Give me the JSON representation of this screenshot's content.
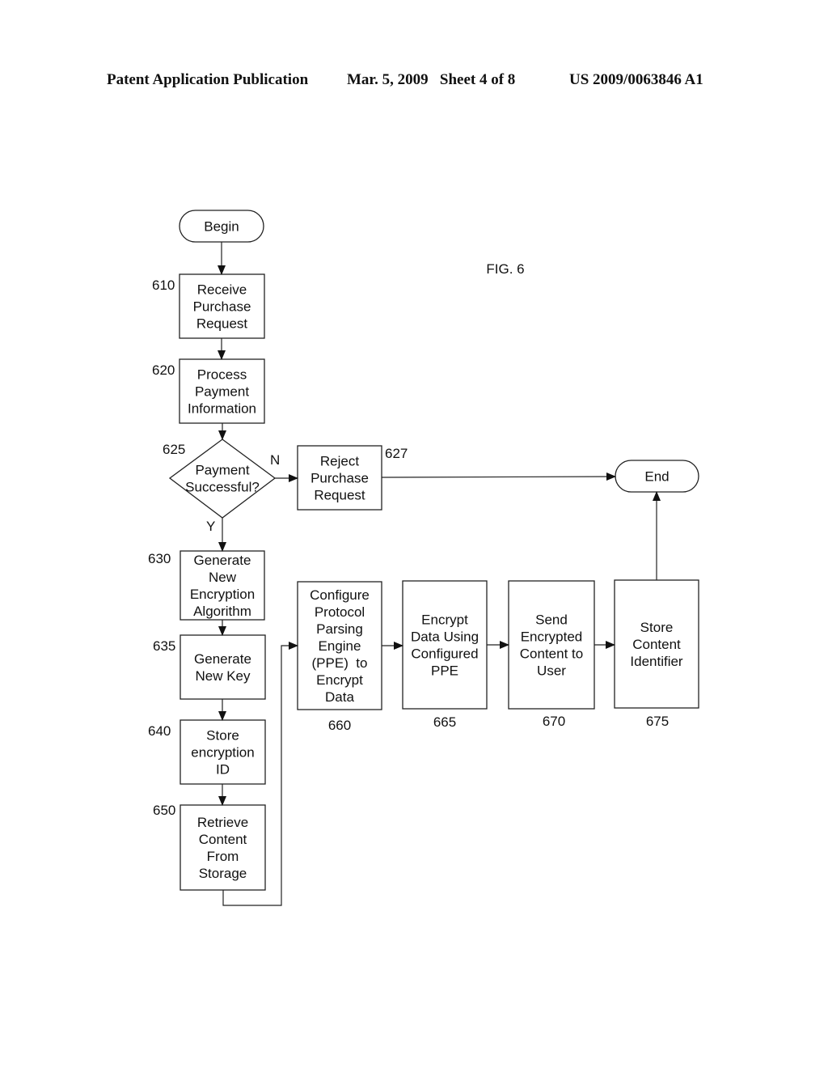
{
  "header": {
    "publication": "Patent Application Publication",
    "date_sheet": "Mar. 5, 2009   Sheet 4 of 8",
    "patent_number": "US 2009/0063846 A1"
  },
  "figure_label": "FIG. 6",
  "nodes": {
    "begin": {
      "lines": [
        "Begin"
      ]
    },
    "n610": {
      "ref": "610",
      "lines": [
        "Receive",
        "Purchase",
        "Request"
      ]
    },
    "n620": {
      "ref": "620",
      "lines": [
        "Process",
        "Payment",
        "Information"
      ]
    },
    "n625": {
      "ref": "625",
      "lines": [
        "Payment",
        "Successful?"
      ]
    },
    "n627": {
      "ref": "627",
      "lines": [
        "Reject",
        "Purchase",
        "Request"
      ]
    },
    "end": {
      "lines": [
        "End"
      ]
    },
    "n630": {
      "ref": "630",
      "lines": [
        "Generate",
        "New",
        "Encryption",
        "Algorithm"
      ]
    },
    "n635": {
      "ref": "635",
      "lines": [
        "Generate",
        "New Key"
      ]
    },
    "n640": {
      "ref": "640",
      "lines": [
        "Store",
        "encryption",
        "ID"
      ]
    },
    "n650": {
      "ref": "650",
      "lines": [
        "Retrieve",
        "Content",
        "From",
        "Storage"
      ]
    },
    "n660": {
      "ref": "660",
      "lines": [
        "Configure",
        "Protocol",
        "Parsing",
        "Engine",
        "(PPE)  to",
        "Encrypt",
        "Data"
      ]
    },
    "n665": {
      "ref": "665",
      "lines": [
        "Encrypt",
        "Data Using",
        "Configured",
        "PPE"
      ]
    },
    "n670": {
      "ref": "670",
      "lines": [
        "Send",
        "Encrypted",
        "Content to",
        "User"
      ]
    },
    "n675": {
      "ref": "675",
      "lines": [
        "Store",
        "Content",
        "Identifier"
      ]
    }
  },
  "edge_labels": {
    "no": "N",
    "yes": "Y"
  }
}
